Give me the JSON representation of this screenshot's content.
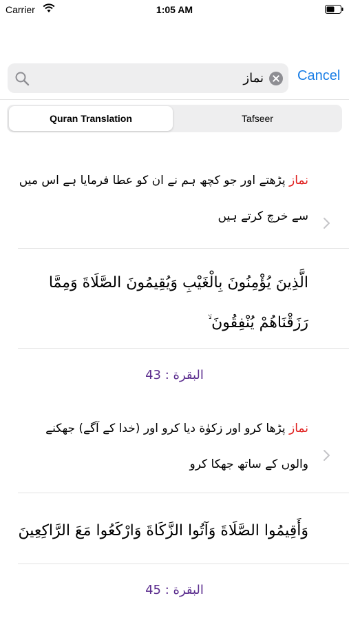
{
  "status_bar": {
    "carrier": "Carrier",
    "time": "1:05 AM"
  },
  "search": {
    "query": "نماز",
    "cancel_label": "Cancel"
  },
  "tabs": [
    {
      "label": "Quran Translation",
      "active": true
    },
    {
      "label": "Tafseer",
      "active": false
    }
  ],
  "results": [
    {
      "highlight": "نماز",
      "translation_rest": " پڑھتے اور جو کچھ ہم نے ان کو عطا فرمایا ہے اس میں سے خرچ کرتے ہیں",
      "arabic": "الَّذِينَ يُؤْمِنُونَ بِالْغَيْبِ وَيُقِيمُونَ الصَّلَاةَ وَمِمَّا رَزَقْنَاهُمْ يُنْفِقُونَ ۙ",
      "surah": "البقرة",
      "ayah": "43"
    },
    {
      "highlight": "نماز",
      "translation_rest": " پڑھا کرو اور زکوٰة دیا کرو اور (خدا کے آگے) جھکنے والوں کے ساتھ جھکا کرو",
      "arabic": "وَأَقِيمُوا الصَّلَاةَ وَآتُوا الزَّكَاةَ وَارْكَعُوا مَعَ الرَّاكِعِينَ",
      "surah": "البقرة",
      "ayah": "45"
    }
  ],
  "colors": {
    "accent": "#1a7ee6",
    "highlight": "#e0201f",
    "reference": "#5b2d8e"
  },
  "icons": [
    "wifi-icon",
    "battery-icon",
    "search-icon",
    "clear-icon",
    "chevron-right-icon"
  ]
}
